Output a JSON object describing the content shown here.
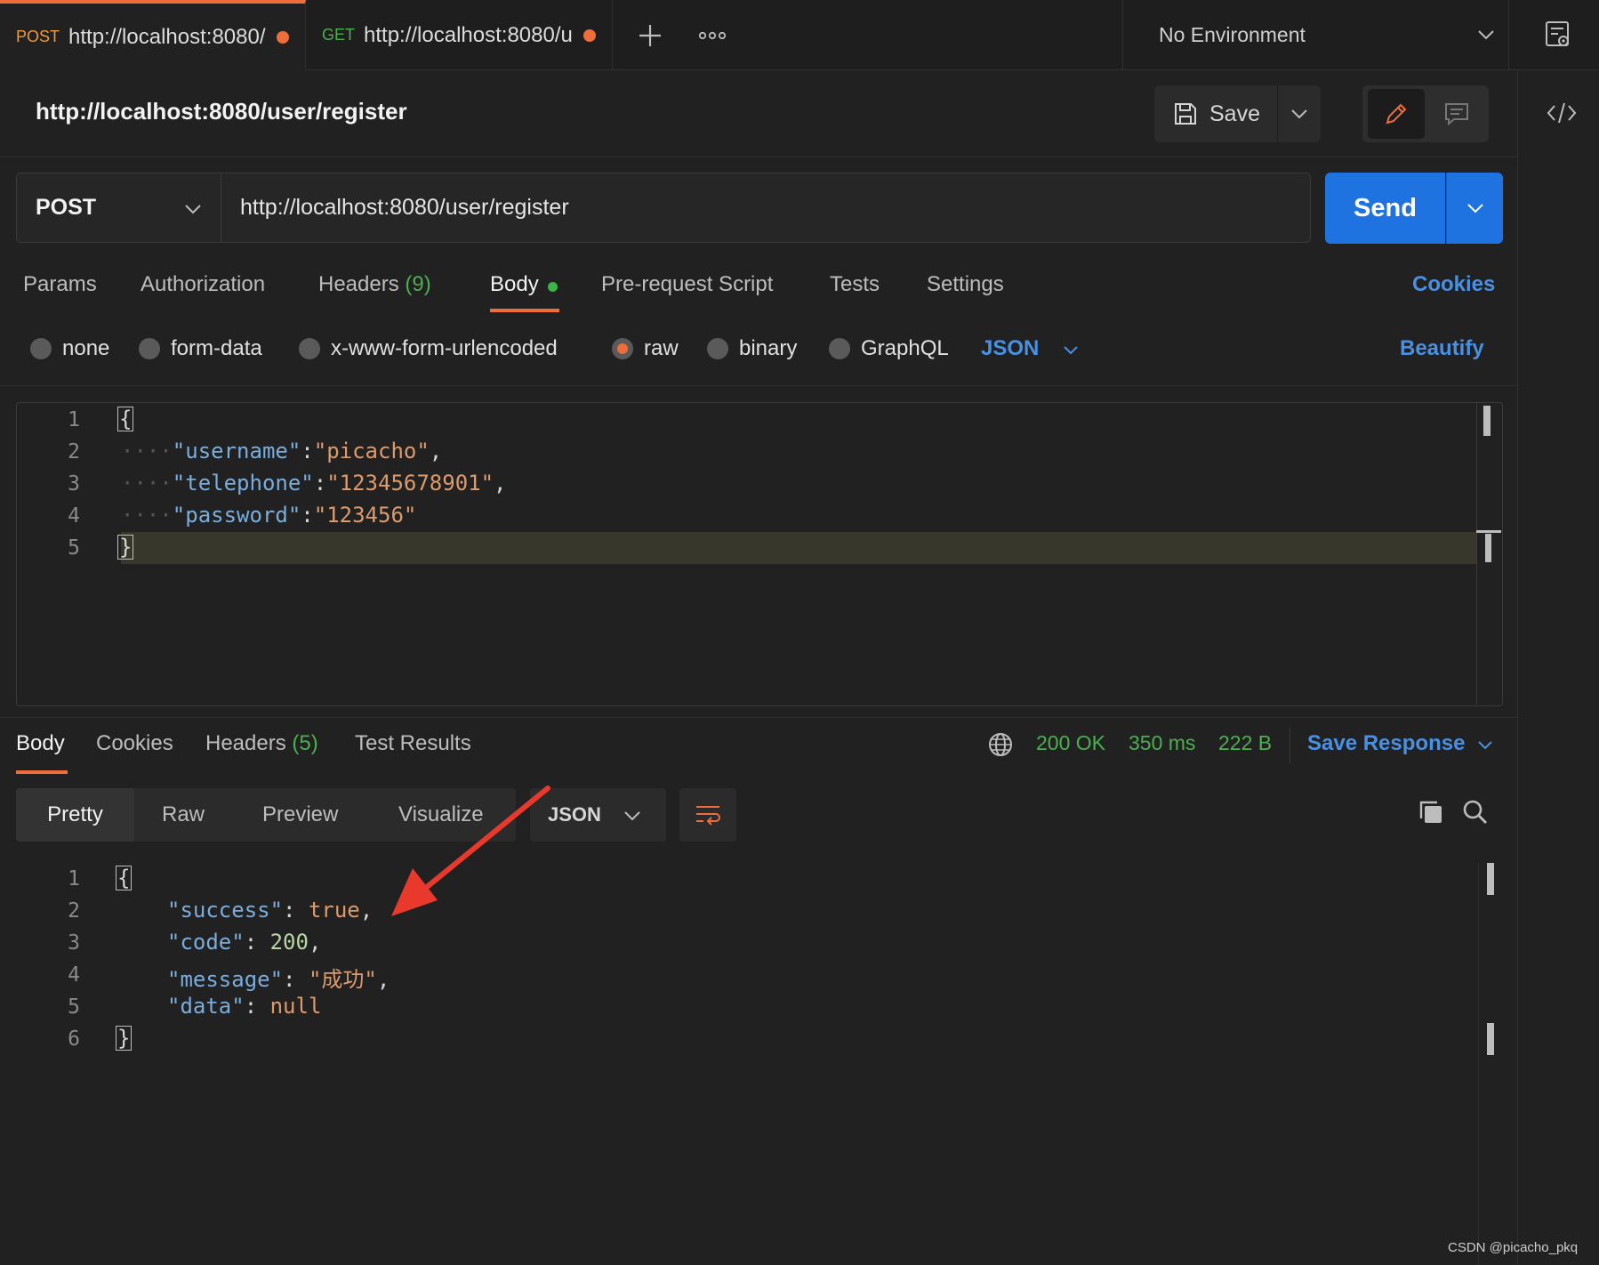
{
  "tabs": [
    {
      "method": "POST",
      "url": "http://localhost:8080/",
      "method_color": "#ee9b3a"
    },
    {
      "method": "GET",
      "url": "http://localhost:8080/u",
      "method_color": "#4caf50"
    }
  ],
  "environment": {
    "selected": "No Environment"
  },
  "request": {
    "title": "http://localhost:8080/user/register",
    "method": "POST",
    "url": "http://localhost:8080/user/register",
    "save_label": "Save",
    "send_label": "Send"
  },
  "request_tabs": [
    {
      "label": "Params"
    },
    {
      "label": "Authorization"
    },
    {
      "label": "Headers",
      "count": "(9)"
    },
    {
      "label": "Body"
    },
    {
      "label": "Pre-request Script"
    },
    {
      "label": "Tests"
    },
    {
      "label": "Settings"
    }
  ],
  "cookies_link": "Cookies",
  "body_modes": [
    "none",
    "form-data",
    "x-www-form-urlencoded",
    "raw",
    "binary",
    "GraphQL"
  ],
  "body_mode_selected": "raw",
  "body_format": "JSON",
  "beautify_label": "Beautify",
  "request_body": {
    "line_numbers": [
      "1",
      "2",
      "3",
      "4",
      "5"
    ],
    "fields": [
      {
        "key": "\"username\"",
        "value": "\"picacho\"",
        "trail": ","
      },
      {
        "key": "\"telephone\"",
        "value": "\"12345678901\"",
        "trail": ","
      },
      {
        "key": "\"password\"",
        "value": "\"123456\"",
        "trail": ""
      }
    ]
  },
  "response_tabs": [
    {
      "label": "Body"
    },
    {
      "label": "Cookies"
    },
    {
      "label": "Headers",
      "count": "(5)"
    },
    {
      "label": "Test Results"
    }
  ],
  "response_status": {
    "code": "200 OK",
    "time": "350 ms",
    "size": "222 B"
  },
  "save_response_label": "Save Response",
  "response_views": [
    "Pretty",
    "Raw",
    "Preview",
    "Visualize"
  ],
  "response_format": "JSON",
  "response_body": {
    "line_numbers": [
      "1",
      "2",
      "3",
      "4",
      "5",
      "6"
    ],
    "fields": [
      {
        "key": "\"success\"",
        "value": "true",
        "trail": ","
      },
      {
        "key": "\"code\"",
        "value": "200",
        "trail": ","
      },
      {
        "key": "\"message\"",
        "value": "\"成功\"",
        "trail": ","
      },
      {
        "key": "\"data\"",
        "value": "null",
        "trail": ""
      }
    ]
  },
  "watermark": "CSDN @picacho_pkq",
  "colors": {
    "accent": "#ee6d3a",
    "send": "#1f73e0",
    "link": "#4a90e2",
    "status_ok": "#4caf50"
  },
  "icons": [
    "plus-icon",
    "more-icon",
    "environment-quicklook-icon",
    "code-snippet-icon",
    "save-icon",
    "pencil-icon",
    "comment-icon",
    "chevron-down-icon",
    "globe-icon",
    "wrap-icon",
    "copy-icon",
    "search-icon",
    "annotation-arrow"
  ]
}
